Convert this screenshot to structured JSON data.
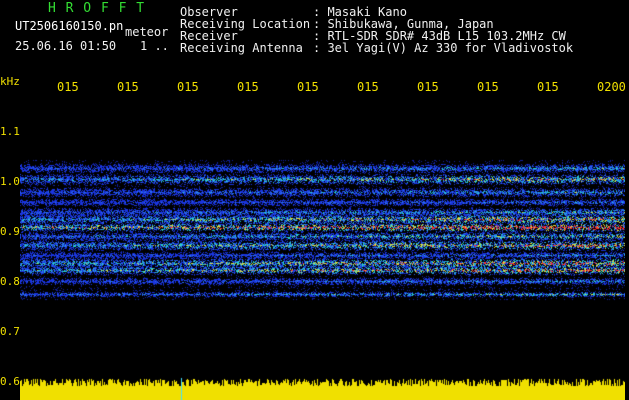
{
  "header": {
    "brand": "H R O F F T",
    "filename": "UT2506160150.pn",
    "mode": "meteor",
    "datetime": "25.06.16 01:50",
    "page_indicator": "1 ..",
    "fields": [
      {
        "label": "Observer",
        "value": ": Masaki Kano"
      },
      {
        "label": "Receiving Location",
        "value": ": Shibukawa, Gunma, Japan"
      },
      {
        "label": "Receiver",
        "value": ": RTL-SDR SDR# 43dB L15 103.2MHz CW"
      },
      {
        "label": "Receiving Antenna",
        "value": ": 3el Yagi(V) Az 330 for Vladivostok"
      }
    ]
  },
  "axis": {
    "unit": "kHz",
    "y_ticks": [
      "1.1",
      "1.0",
      "0.9",
      "0.8",
      "0.7",
      "0.6"
    ],
    "x_ticks": [
      "015",
      "015",
      "015",
      "015",
      "015",
      "015",
      "015",
      "015",
      "015",
      "0200"
    ]
  },
  "colors": {
    "noise": "#1a2fd0",
    "signal_mid": "#27c9d9",
    "signal_high": "#ff3030",
    "baseline": "#f0e000"
  }
}
